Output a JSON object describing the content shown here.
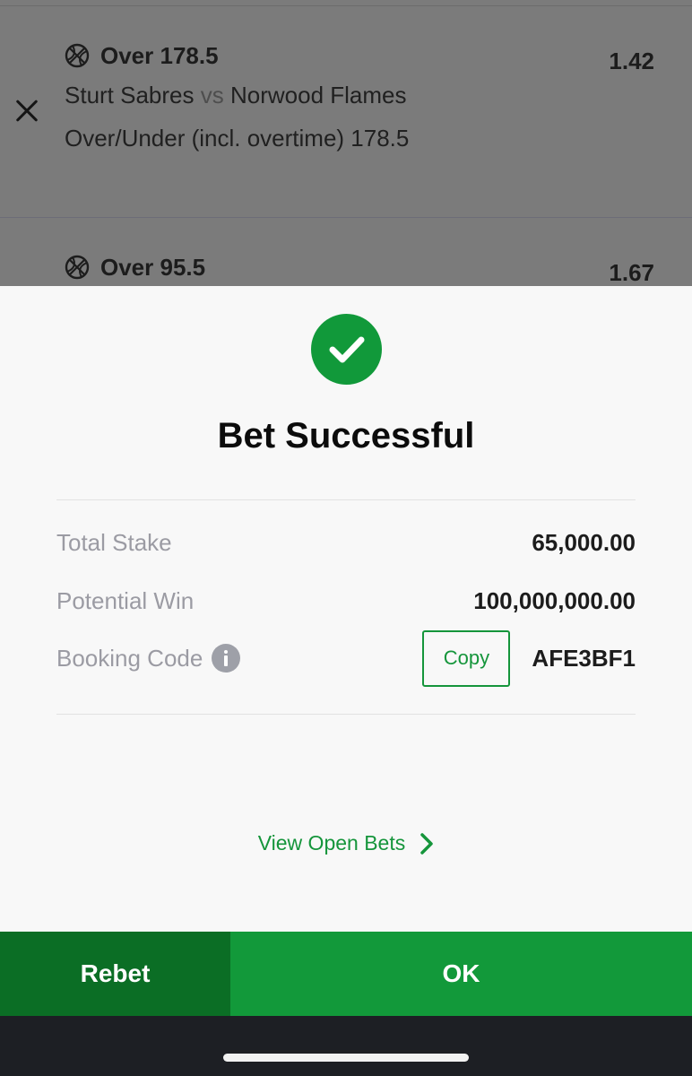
{
  "selections": [
    {
      "title": "Over 178.5",
      "odds": "1.42",
      "home_team": "Sturt Sabres",
      "vs": "vs",
      "away_team": "Norwood Flames",
      "market": "Over/Under (incl. overtime) 178.5",
      "sport_icon": "basketball-icon"
    },
    {
      "title": "Over 95.5",
      "odds": "1.67",
      "sport_icon": "basketball-icon"
    }
  ],
  "modal": {
    "title": "Bet Successful",
    "status_icon": "checkmark-circle-icon",
    "rows": {
      "total_stake": {
        "label": "Total Stake",
        "value": "65,000.00"
      },
      "potential_win": {
        "label": "Potential Win",
        "value": "100,000,000.00"
      },
      "booking_code": {
        "label": "Booking Code",
        "copy_label": "Copy",
        "value": "AFE3BF1"
      }
    },
    "view_open_bets": "View Open Bets"
  },
  "buttons": {
    "rebet": "Rebet",
    "ok": "OK"
  },
  "colors": {
    "accent_green": "#12993a",
    "dark_green": "#0b6e25",
    "overlay_gray": "#7b7b7b"
  }
}
